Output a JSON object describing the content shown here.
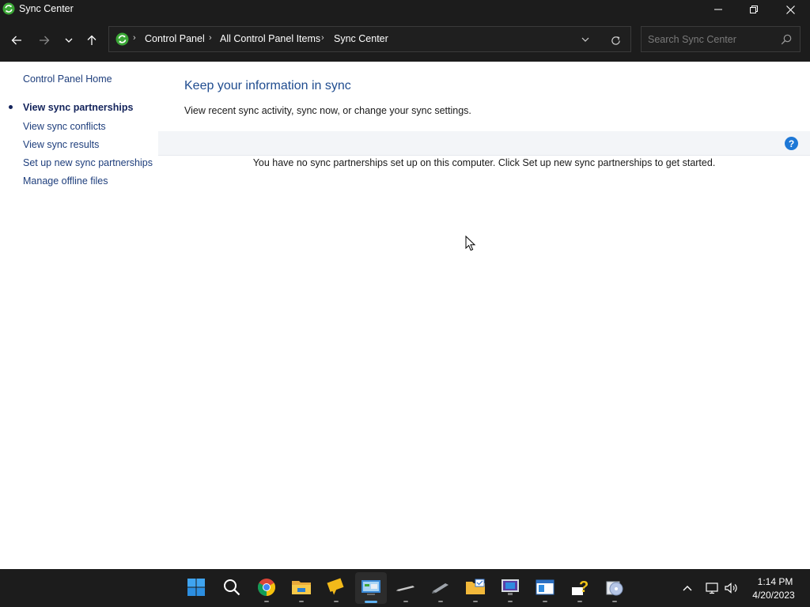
{
  "window": {
    "title": "Sync Center"
  },
  "address_bar": {
    "breadcrumbs": [
      "Control Panel",
      "All Control Panel Items",
      "Sync Center"
    ]
  },
  "search": {
    "placeholder": "Search Sync Center",
    "value": ""
  },
  "sidebar": {
    "home": "Control Panel Home",
    "items": [
      {
        "label": "View sync partnerships",
        "selected": true
      },
      {
        "label": "View sync conflicts",
        "selected": false
      },
      {
        "label": "View sync results",
        "selected": false
      },
      {
        "label": "Set up new sync partnerships",
        "selected": false
      },
      {
        "label": "Manage offline files",
        "selected": false
      }
    ]
  },
  "main": {
    "title": "Keep your information in sync",
    "subtitle": "View recent sync activity, sync now, or change your sync settings.",
    "help_label": "?",
    "empty_message": "You have no sync partnerships set up on this computer. Click Set up new sync partnerships to get started."
  },
  "taskbar": {
    "apps": [
      "start-icon",
      "search-icon",
      "chrome-icon",
      "file-explorer-icon",
      "feedback-icon",
      "control-panel-icon",
      "pen-icon",
      "stylus-icon",
      "tasks-folder-icon",
      "remote-desktop-icon",
      "window-icon",
      "help-icon",
      "disc-tools-icon"
    ],
    "active_app": "control-panel-icon",
    "time": "1:14 PM",
    "date": "4/20/2023"
  },
  "colors": {
    "chrome_bg": "#1c1c1c",
    "link": "#1e3e7c",
    "heading": "#1f4c8f",
    "help_blue": "#1e78d6",
    "accent": "#5fb2f2"
  }
}
